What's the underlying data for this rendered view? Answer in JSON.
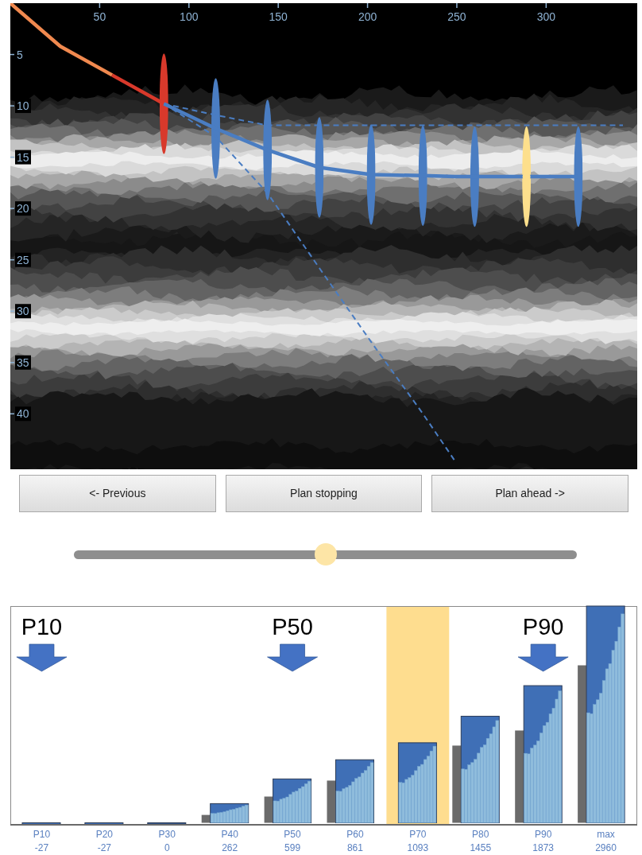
{
  "well_plot": {
    "chart_data": {
      "type": "line",
      "x": [
        0,
        28,
        57,
        86,
        115,
        144,
        173,
        202,
        231,
        249,
        260,
        289,
        318,
        343
      ],
      "xlim": [
        0,
        351
      ],
      "ylim": [
        45.4,
        0
      ],
      "xticks": [
        50,
        100,
        150,
        200,
        250,
        300
      ],
      "yticks": [
        5,
        10,
        15,
        20,
        25,
        30,
        35,
        40
      ],
      "series": [
        {
          "color": "#f0894f",
          "values": [
            0,
            4.2,
            7.0,
            null,
            null,
            null,
            null,
            null,
            null,
            null,
            null,
            null,
            null,
            null
          ]
        },
        {
          "color": "#d8392b",
          "values": [
            null,
            null,
            7.0,
            9.8,
            null,
            null,
            null,
            null,
            null,
            null,
            null,
            null,
            null,
            null
          ],
          "errors": [
            null,
            null,
            null,
            4.9,
            null,
            null,
            null,
            null,
            null,
            null,
            null,
            null,
            null,
            null
          ]
        },
        {
          "color": "#4a7dc2",
          "values": [
            null,
            null,
            null,
            9.8,
            12.2,
            14.3,
            16.0,
            16.7,
            16.8,
            16.9,
            16.9,
            16.9,
            16.9,
            null
          ],
          "errors": [
            null,
            null,
            null,
            null,
            4.9,
            4.9,
            4.9,
            4.9,
            4.9,
            null,
            4.9,
            null,
            4.9,
            null
          ]
        },
        {
          "color": "#4a7dc2",
          "line_style": "dashed",
          "values": [
            null,
            null,
            null,
            9.8,
            10.9,
            11.9,
            11.9,
            11.9,
            11.9,
            11.9,
            11.9,
            11.9,
            11.9,
            11.9
          ]
        },
        {
          "color": "#4a7dc2",
          "line_style": "dashed",
          "values": [
            null,
            null,
            null,
            9.8,
            13.0,
            18.5,
            25.8,
            33.0,
            40.0,
            44.6,
            null,
            null,
            null,
            null
          ]
        },
        {
          "color": "#fddf8c",
          "line_style": "none",
          "marker": "circle",
          "values": [
            null,
            null,
            null,
            null,
            null,
            null,
            null,
            null,
            null,
            null,
            null,
            16.9,
            null,
            null
          ],
          "errors": [
            null,
            null,
            null,
            null,
            null,
            null,
            null,
            null,
            null,
            null,
            null,
            4.9,
            null,
            null
          ]
        }
      ]
    }
  },
  "buttons": [
    {
      "label": "<- Previous"
    },
    {
      "label": "Plan stopping"
    },
    {
      "label": "Plan ahead ->"
    }
  ],
  "slider": {
    "level": 0.5
  },
  "distribution_chart": {
    "columns": [
      {
        "selected": false
      },
      {
        "selected": false
      },
      {
        "selected": false
      },
      {
        "selected": false
      },
      {
        "selected": false
      },
      {
        "selected": false
      },
      {
        "selected": true
      },
      {
        "selected": false
      },
      {
        "selected": false
      },
      {
        "selected": false
      }
    ],
    "chart_data": {
      "type": "bar",
      "data_labels": true,
      "categories": [
        "P10",
        "P20",
        "P30",
        "P40",
        "P50",
        "P60",
        "P70",
        "P80",
        "P90",
        "max"
      ],
      "series": [
        {
          "color": "#3f6fb6",
          "values": [
            -27,
            -27,
            0,
            262,
            599,
            861,
            1093,
            1455,
            1873,
            2960
          ]
        }
      ],
      "annotations": [
        "P10",
        "P50",
        "P90"
      ]
    }
  }
}
